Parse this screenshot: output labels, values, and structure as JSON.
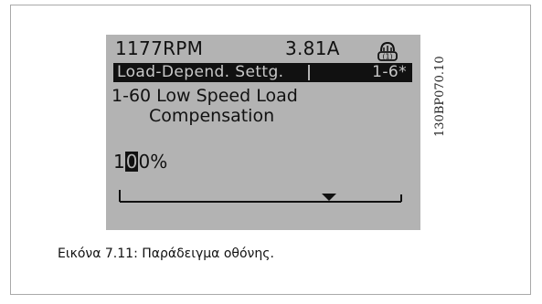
{
  "status": {
    "speed": "1177RPM",
    "current": "3.81A",
    "hand_icon_label": "(1)"
  },
  "menu": {
    "group_title": "Load-Depend. Settg.",
    "group_index": "1-6*"
  },
  "parameter": {
    "name_line1": "1-60 Low Speed Load",
    "name_line2": "Compensation",
    "value_prefix": "1",
    "value_cursor": "0",
    "value_suffix": "0%"
  },
  "figure": {
    "code": "130BP070.10",
    "caption": "Εικόνα 7.11: Παράδειγμα οθόνης."
  },
  "colors": {
    "lcd_background": "#b3b3b3",
    "lcd_text": "#111111"
  },
  "icons": [
    "hand-on-icon",
    "scale-marker-icon"
  ]
}
